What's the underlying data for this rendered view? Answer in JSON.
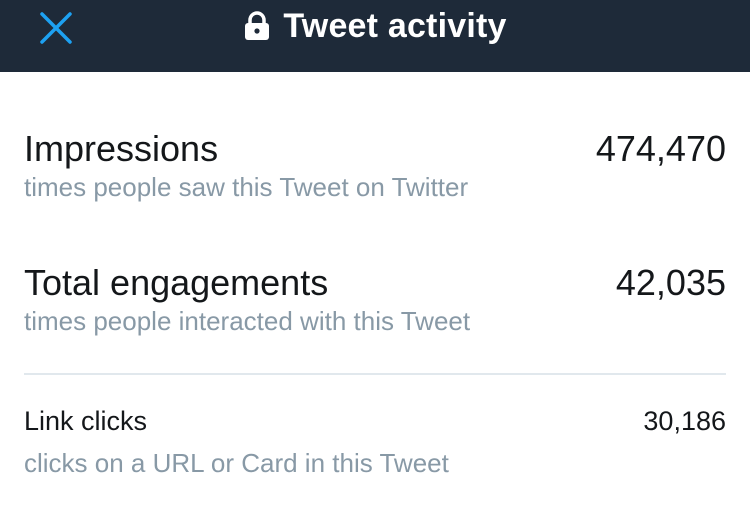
{
  "header": {
    "title": "Tweet activity",
    "close_icon": "close-icon",
    "lock_icon": "lock-icon",
    "background": "#1e2a39",
    "accent": "#1da1f2"
  },
  "metrics": [
    {
      "label": "Impressions",
      "value": "474,470",
      "description": "times people saw this Tweet on Twitter"
    },
    {
      "label": "Total engagements",
      "value": "42,035",
      "description": "times people interacted with this Tweet"
    },
    {
      "label": "Link clicks",
      "value": "30,186",
      "description": "clicks on a URL or Card in this Tweet"
    }
  ]
}
